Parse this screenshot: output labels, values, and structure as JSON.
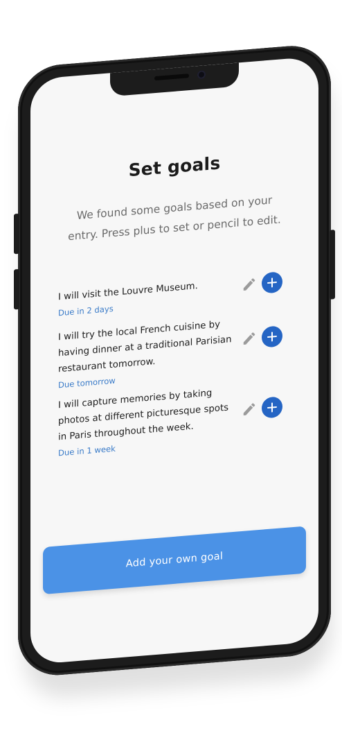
{
  "screen": {
    "title": "Set goals",
    "subtitle": "We found some goals based on your entry. Press plus to set or pencil to edit."
  },
  "goals": [
    {
      "text": "I will visit the Louvre Museum.",
      "due": "Due in 2 days"
    },
    {
      "text": "I will try the local French cuisine by having dinner at a traditional Parisian restaurant tomorrow.",
      "due": "Due tomorrow"
    },
    {
      "text": "I will capture memories by taking photos at different picturesque spots in Paris throughout the week.",
      "due": "Due in 1 week"
    }
  ],
  "actions": {
    "add_own_goal": "Add your own goal"
  },
  "icons": {
    "edit": "pencil-icon",
    "add": "plus-icon"
  },
  "colors": {
    "accent": "#2565c4",
    "primary_button": "#4b92e6",
    "due_text": "#3a7bc8",
    "screen_bg": "#f7f7f7",
    "phone_frame": "#1c1c1c"
  }
}
